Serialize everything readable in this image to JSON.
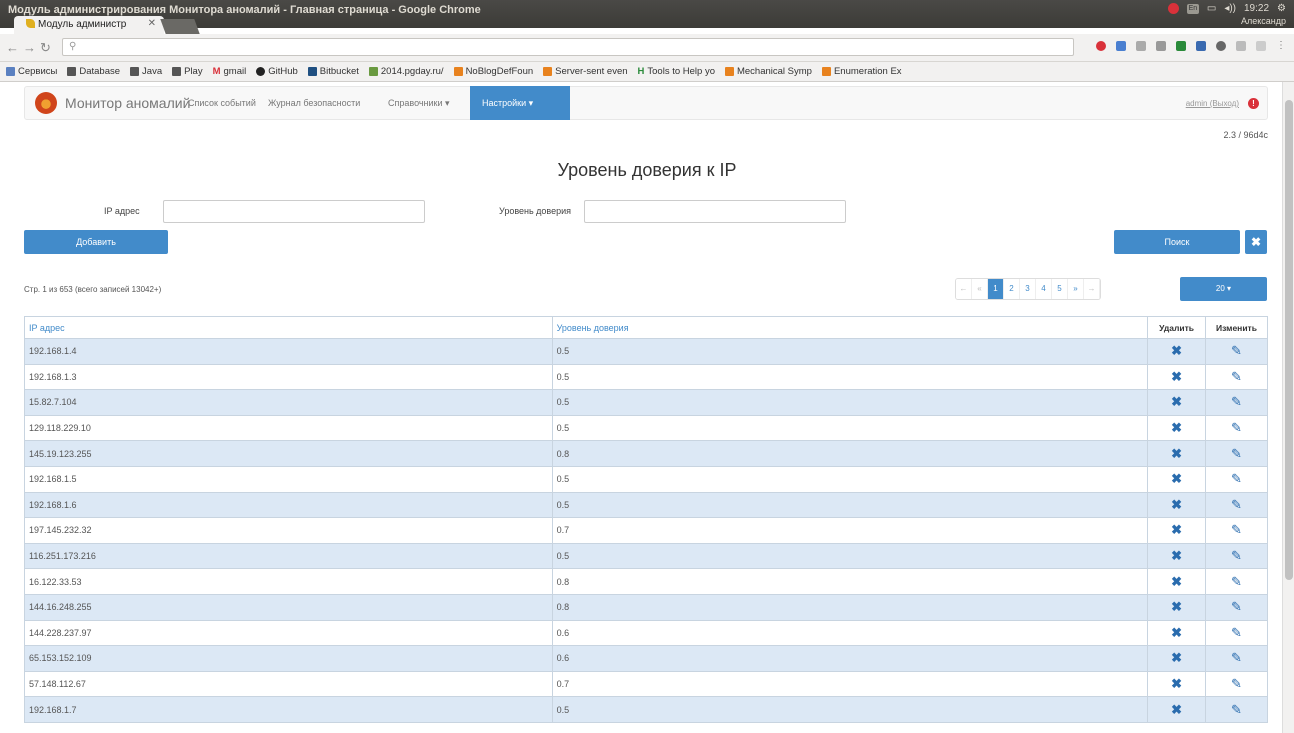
{
  "os": {
    "window_title": "Модуль администрирования Монитора аномалий - Главная страница - Google Chrome",
    "time": "19:22",
    "user": "Александр",
    "lang": "En"
  },
  "browser": {
    "tab_label": "Модуль администр",
    "omnibox": "",
    "bookmarks": [
      "Сервисы",
      "Database",
      "Java",
      "Play",
      "gmail",
      "GitHub",
      "Bitbucket",
      "2014.pgday.ru/",
      "NoBlogDefFoun",
      "Server-sent even",
      "Tools to Help yo",
      "Mechanical Symp",
      "Enumeration Ex"
    ]
  },
  "navbar": {
    "brand": "Монитор аномалий",
    "links": [
      "Список событий",
      "Журнал безопасности",
      "Справочники ▾"
    ],
    "active": "Настройки ▾",
    "admin": "admin (Выход)",
    "badge": "!"
  },
  "version": "2.3 / 96d4c",
  "title": "Уровень доверия к IP",
  "filters": {
    "ip_label": "IP адрес",
    "trust_label": "Уровень доверия"
  },
  "buttons": {
    "add": "Добавить",
    "search": "Поиск",
    "clear": "✖"
  },
  "page_info": "Стр. 1 из 653 (всего записей 13042+)",
  "pager": [
    "←",
    "«",
    "1",
    "2",
    "3",
    "4",
    "5",
    "»",
    "→"
  ],
  "page_size": "20 ▾",
  "table": {
    "headers": [
      "IP адрес",
      "Уровень доверия",
      "Удалить",
      "Изменить"
    ],
    "rows": [
      [
        "192.168.1.4",
        "0.5"
      ],
      [
        "192.168.1.3",
        "0.5"
      ],
      [
        "15.82.7.104",
        "0.5"
      ],
      [
        "129.118.229.10",
        "0.5"
      ],
      [
        "145.19.123.255",
        "0.8"
      ],
      [
        "192.168.1.5",
        "0.5"
      ],
      [
        "192.168.1.6",
        "0.5"
      ],
      [
        "197.145.232.32",
        "0.7"
      ],
      [
        "116.251.173.216",
        "0.5"
      ],
      [
        "16.122.33.53",
        "0.8"
      ],
      [
        "144.16.248.255",
        "0.8"
      ],
      [
        "144.228.237.97",
        "0.6"
      ],
      [
        "65.153.152.109",
        "0.6"
      ],
      [
        "57.148.112.67",
        "0.7"
      ],
      [
        "192.168.1.7",
        "0.5"
      ]
    ]
  }
}
